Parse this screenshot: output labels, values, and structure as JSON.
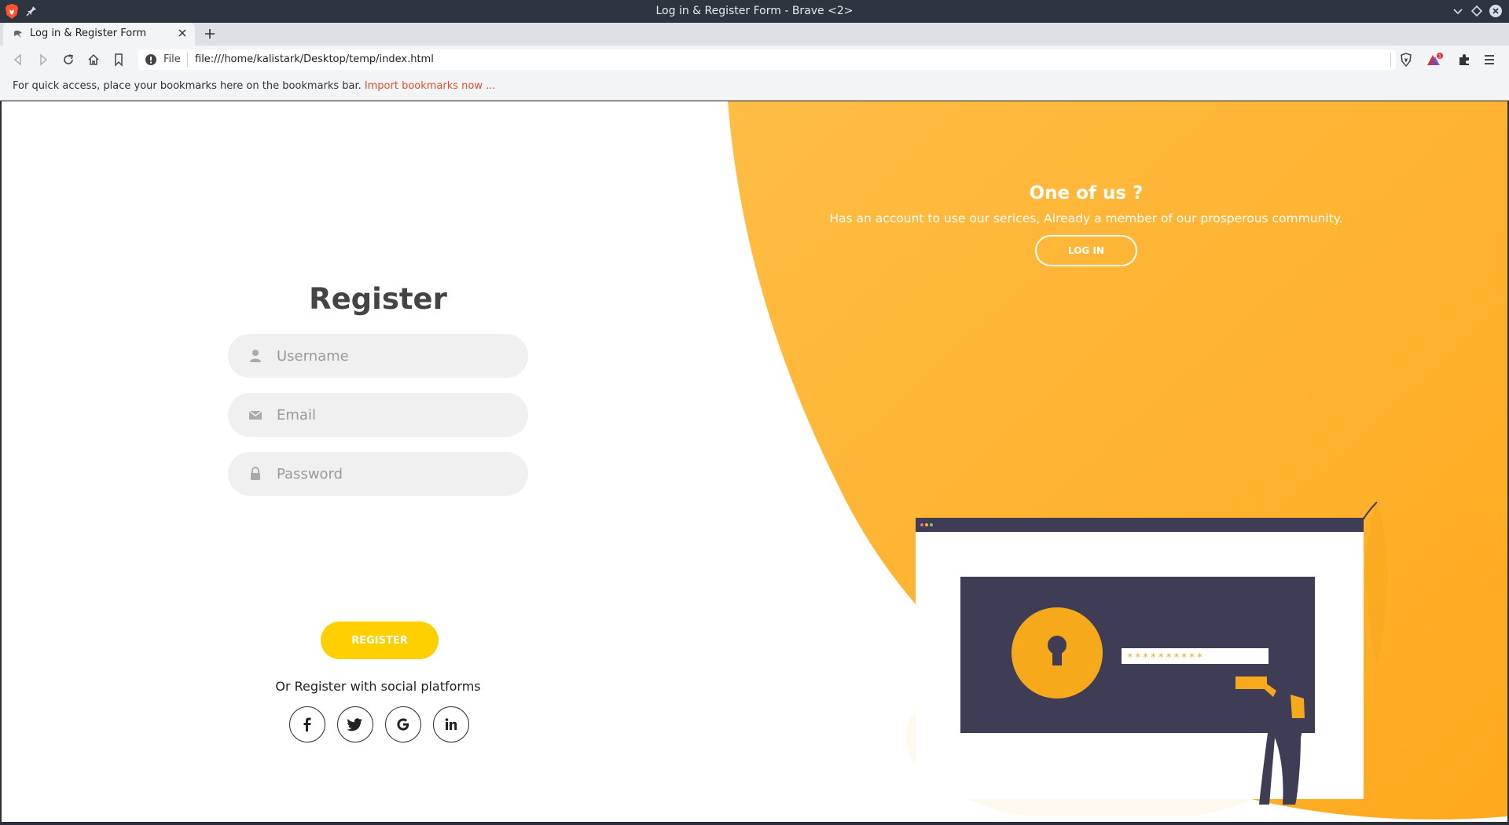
{
  "window": {
    "title": "Log in & Register Form - Brave <2>"
  },
  "tabs": [
    {
      "title": "Log in & Register Form"
    }
  ],
  "toolbar": {
    "scheme": "File",
    "url": "file:///home/kalistark/Desktop/temp/index.html",
    "rewards_badge": "1"
  },
  "bookmarks_bar": {
    "text": "For quick access, place your bookmarks here on the bookmarks bar.",
    "link": "Import bookmarks now ..."
  },
  "register": {
    "title": "Register",
    "username_placeholder": "Username",
    "email_placeholder": "Email",
    "password_placeholder": "Password",
    "button": "REGISTER",
    "social_text": "Or Register with social platforms",
    "social": [
      "facebook-icon",
      "twitter-icon",
      "google-icon",
      "linkedin-icon"
    ]
  },
  "login_panel": {
    "title": "One of us ?",
    "text": "Has an account to use our serices, Already a member of our prosperous community.",
    "button": "LOG IN"
  },
  "illustration": {
    "password_mask": "**********"
  },
  "colors": {
    "accent": "#ffb52a",
    "button_yellow": "#ffcf00",
    "dark": "#3f3d56"
  }
}
